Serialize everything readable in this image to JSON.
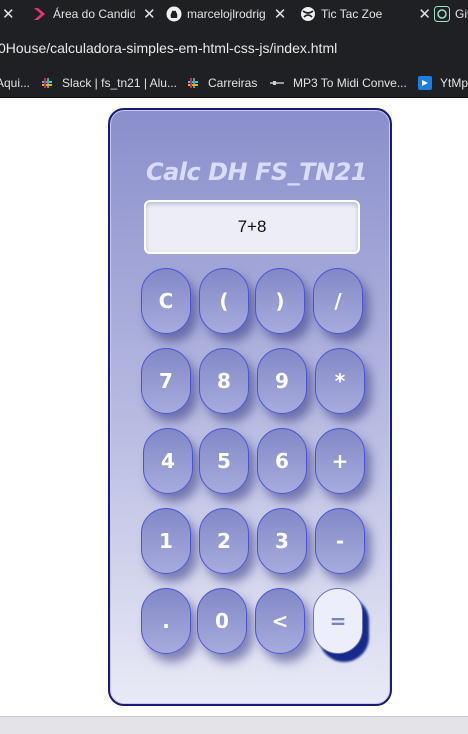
{
  "browser": {
    "tabs": [
      {
        "title": "Área do Candid",
        "icon": "brand-chevron-icon",
        "close": "✕"
      },
      {
        "title": "marcelojlrodrig",
        "icon": "github-icon",
        "close": "✕"
      },
      {
        "title": "Tic Tac Zoe",
        "icon": "globe-icon",
        "close": "✕"
      },
      {
        "title": "Git",
        "icon": "chatgpt-icon"
      }
    ],
    "url": "0House/calculadora-simples-em-html-css-js/index.html",
    "bookmarks": [
      {
        "label": "Aqui...",
        "icon": "bookmark-icon"
      },
      {
        "label": "Slack | fs_tn21 | Alu...",
        "icon": "slack-icon"
      },
      {
        "label": "Carreiras",
        "icon": "slack-icon"
      },
      {
        "label": "MP3 To Midi Conve...",
        "icon": "midi-icon"
      },
      {
        "label": "YtMp",
        "icon": "ytmp-icon"
      }
    ]
  },
  "calculator": {
    "title": "Calc DH FS_TN21",
    "display": "7+8",
    "keys": [
      "C",
      "(",
      ")",
      "/",
      "7",
      "8",
      "9",
      "*",
      "4",
      "5",
      "6",
      "+",
      "1",
      "2",
      "3",
      "-",
      ".",
      "0",
      "<",
      "="
    ]
  },
  "colors": {
    "chrome": "#1f2023",
    "calc_border": "#1a1a7a",
    "key_border": "#4a52d8",
    "title": "#d9dcff"
  }
}
